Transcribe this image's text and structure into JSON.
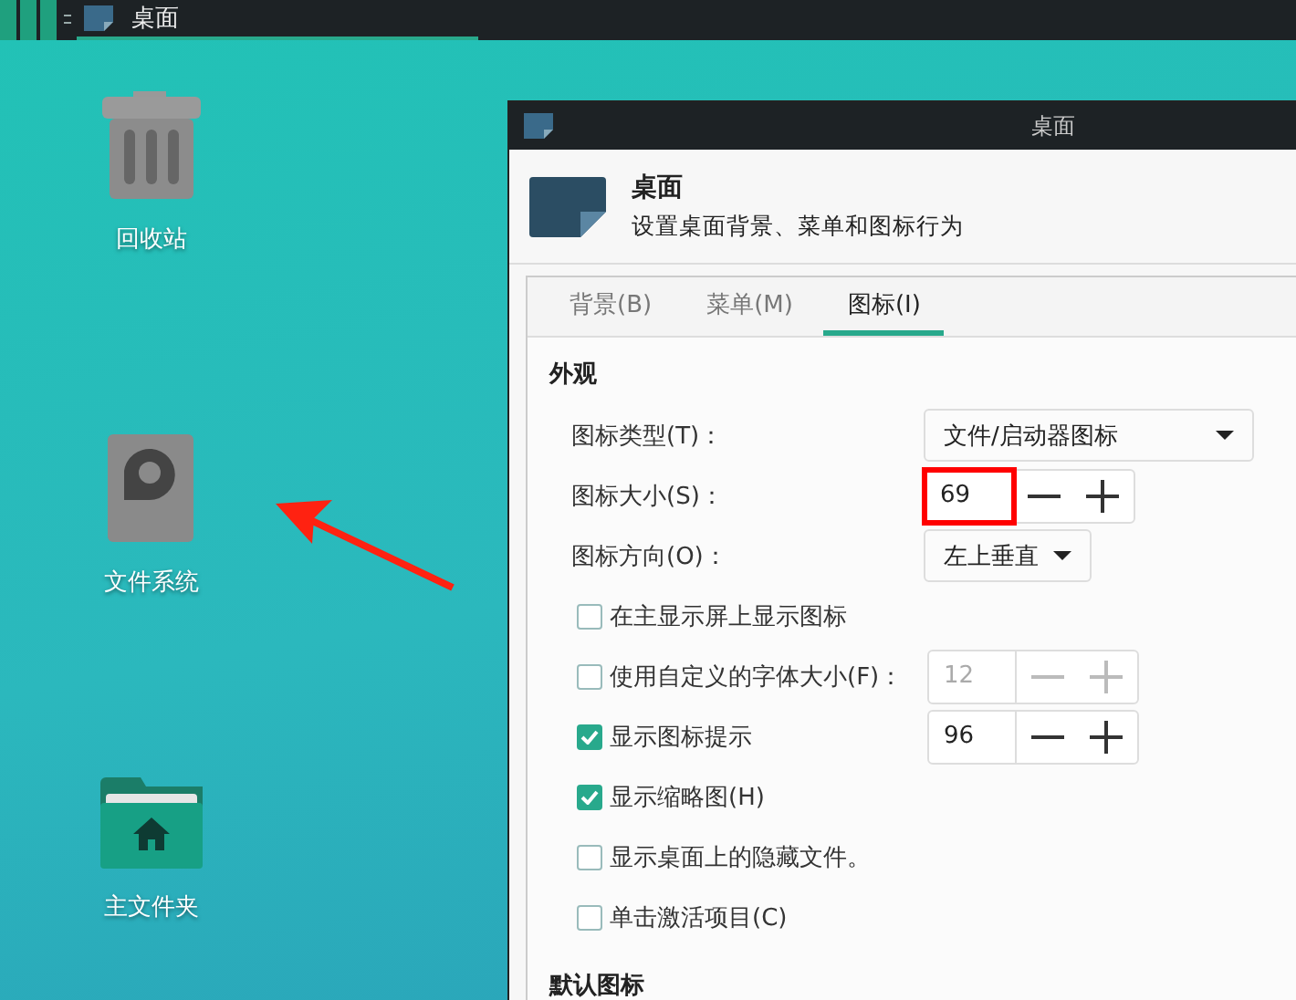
{
  "taskbar": {
    "task": {
      "label": "桌面",
      "selected": true
    }
  },
  "desktop_icons": [
    {
      "label": "回收站",
      "kind": "trash"
    },
    {
      "label": "文件系统",
      "kind": "drive"
    },
    {
      "label": "主文件夹",
      "kind": "home"
    }
  ],
  "window": {
    "title": "桌面",
    "header": {
      "title": "桌面",
      "subtitle": "设置桌面背景、菜单和图标行为"
    },
    "tabs": [
      {
        "label": "背景(B)",
        "selected": false
      },
      {
        "label": "菜单(M)",
        "selected": false
      },
      {
        "label": "图标(I)",
        "selected": true
      }
    ],
    "sections": [
      {
        "title": "外观",
        "rows": [
          {
            "kind": "select",
            "label": "图标类型(T)：",
            "value": "文件/启动器图标",
            "wide": true
          },
          {
            "kind": "spin",
            "label": "图标大小(S)：",
            "value": "69",
            "highlighted": true,
            "disabled": false
          },
          {
            "kind": "select",
            "label": "图标方向(O)：",
            "value": "左上垂直",
            "wide": false
          },
          {
            "kind": "check",
            "label": "在主显示屏上显示图标",
            "checked": false
          },
          {
            "kind": "check",
            "label": "使用自定义的字体大小(F)：",
            "checked": false,
            "spin": {
              "value": "12",
              "disabled": true,
              "highlighted": false
            }
          },
          {
            "kind": "check",
            "label": "显示图标提示",
            "checked": true,
            "spin": {
              "value": "96",
              "disabled": false,
              "highlighted": false
            }
          },
          {
            "kind": "check",
            "label": "显示缩略图(H)",
            "checked": true
          },
          {
            "kind": "check",
            "label": "显示桌面上的隐藏文件。",
            "checked": false
          },
          {
            "kind": "check",
            "label": "单击激活项目(C)",
            "checked": false
          }
        ]
      },
      {
        "title": "默认图标"
      }
    ]
  }
}
